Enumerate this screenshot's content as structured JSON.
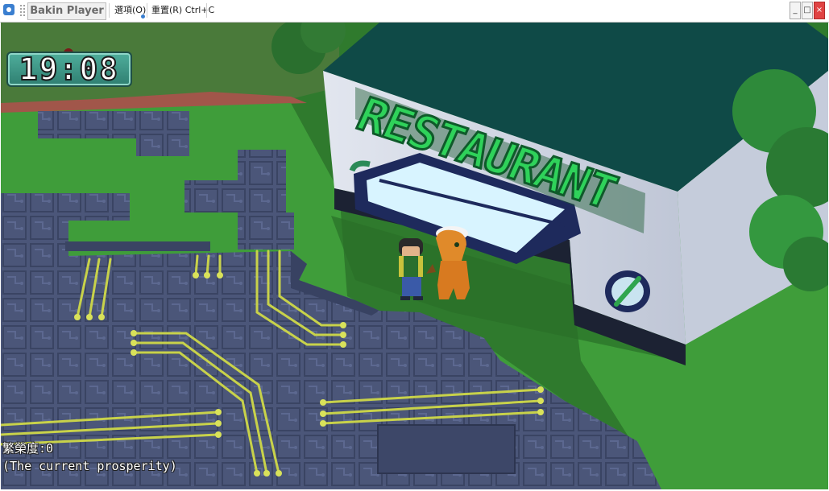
{
  "window": {
    "title": "Bakin Player",
    "menu_options": "選項(O)",
    "menu_reset": "重置(R) Ctrl+C",
    "minimize": "_",
    "maximize": "□",
    "close": "×"
  },
  "hud": {
    "clock_time": "19:08",
    "prosperity_label": "繁榮度:0",
    "prosperity_desc": "(The current prosperity)"
  },
  "sign": {
    "text": "RESTAURANT"
  },
  "colors": {
    "grass": "#3d9b3a",
    "circuit_floor": "#4a5477",
    "circuit_trace": "#c8d24a",
    "building_wall": "#d6dbe6",
    "building_roof": "#0f4a47",
    "sign_green": "#2fd25a",
    "clock_bg": "#3f9b8a"
  }
}
